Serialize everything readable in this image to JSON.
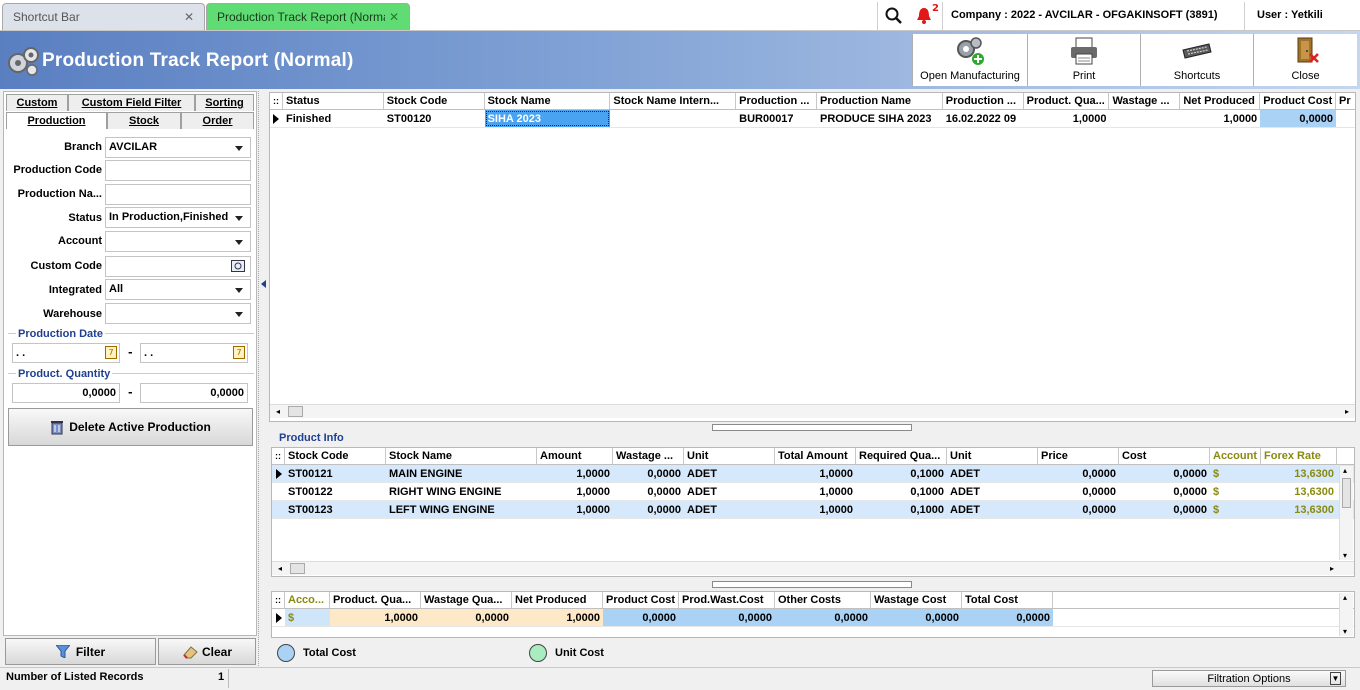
{
  "tabs": [
    {
      "label": "Shortcut Bar",
      "active": false
    },
    {
      "label": "Production Track Report (Normal)",
      "active": true
    }
  ],
  "top": {
    "notification_count": "2",
    "company": "Company : 2022 - AVCILAR - OFGAKINSOFT (3891)",
    "user": "User : Yetkili"
  },
  "window": {
    "title": "Production Track Report (Normal)"
  },
  "toolbar": {
    "open_manufacturing": "Open Manufacturing",
    "print": "Print",
    "shortcuts": "Shortcuts",
    "close": "Close"
  },
  "left_tabs_row1": [
    "Custom",
    "Custom Field Filter",
    "Sorting"
  ],
  "left_tabs_row2": [
    "Production",
    "Stock",
    "Order"
  ],
  "filters": {
    "branch": {
      "label": "Branch",
      "value": "AVCILAR"
    },
    "production_code": {
      "label": "Production Code",
      "value": ""
    },
    "production_name": {
      "label": "Production Na...",
      "value": ""
    },
    "status": {
      "label": "Status",
      "value": "In Production,Finished"
    },
    "account": {
      "label": "Account",
      "value": ""
    },
    "custom_code": {
      "label": "Custom Code",
      "value": ""
    },
    "integrated": {
      "label": "Integrated",
      "value": "All"
    },
    "warehouse": {
      "label": "Warehouse",
      "value": ""
    }
  },
  "production_date": {
    "label": "Production Date",
    "from": ". .",
    "to": ". .",
    "dash": "-"
  },
  "product_quantity": {
    "label": "Product. Quantity",
    "from": "0,0000",
    "to": "0,0000",
    "dash": "-"
  },
  "delete_button": "Delete Active Production",
  "filter_button": "Filter",
  "clear_button": "Clear",
  "main_grid": {
    "columns": [
      "Status",
      "Stock Code",
      "Stock Name",
      "Stock Name Intern...",
      "Production ...",
      "Production Name",
      "Production ...",
      "Product. Qua...",
      "Wastage ...",
      "Net Produced",
      "Product Cost",
      "Pr"
    ],
    "rows": [
      [
        "Finished",
        "ST00120",
        "SIHA 2023",
        "",
        "BUR00017",
        "PRODUCE SIHA 2023",
        "16.02.2022 09",
        "1,0000",
        "",
        "1,0000",
        "0,0000",
        ""
      ]
    ]
  },
  "product_info": {
    "title": "Product Info",
    "columns": [
      "Stock Code",
      "Stock Name",
      "Amount",
      "Wastage ...",
      "Unit",
      "Total Amount",
      "Required Qua...",
      "Unit",
      "Price",
      "Cost",
      "Account",
      "Forex Rate"
    ],
    "rows": [
      [
        "ST00121",
        "MAIN ENGINE",
        "1,0000",
        "0,0000",
        "ADET",
        "1,0000",
        "0,1000",
        "ADET",
        "0,0000",
        "0,0000",
        "$",
        "13,6300"
      ],
      [
        "ST00122",
        "RIGHT WING ENGINE",
        "1,0000",
        "0,0000",
        "ADET",
        "1,0000",
        "0,1000",
        "ADET",
        "0,0000",
        "0,0000",
        "$",
        "13,6300"
      ],
      [
        "ST00123",
        "LEFT WING ENGINE",
        "1,0000",
        "0,0000",
        "ADET",
        "1,0000",
        "0,1000",
        "ADET",
        "0,0000",
        "0,0000",
        "$",
        "13,6300"
      ]
    ]
  },
  "summary": {
    "columns": [
      "Acco...",
      "Product. Qua...",
      "Wastage Qua...",
      "Net Produced",
      "Product Cost",
      "Prod.Wast.Cost",
      "Other Costs",
      "Wastage Cost",
      "Total Cost"
    ],
    "row": [
      "$",
      "1,0000",
      "0,0000",
      "1,0000",
      "0,0000",
      "0,0000",
      "0,0000",
      "0,0000",
      "0,0000"
    ]
  },
  "legend": {
    "total_cost": "Total Cost",
    "unit_cost": "Unit Cost"
  },
  "status": {
    "records_label": "Number of Listed Records",
    "records_count": "1",
    "filtration_options": "Filtration Options"
  },
  "colors": {
    "accent_green": "#5fdc74",
    "header_blue": "#5a7fc1",
    "cost_blue": "#a9d2f5",
    "cost_green": "#a9ecc0"
  }
}
